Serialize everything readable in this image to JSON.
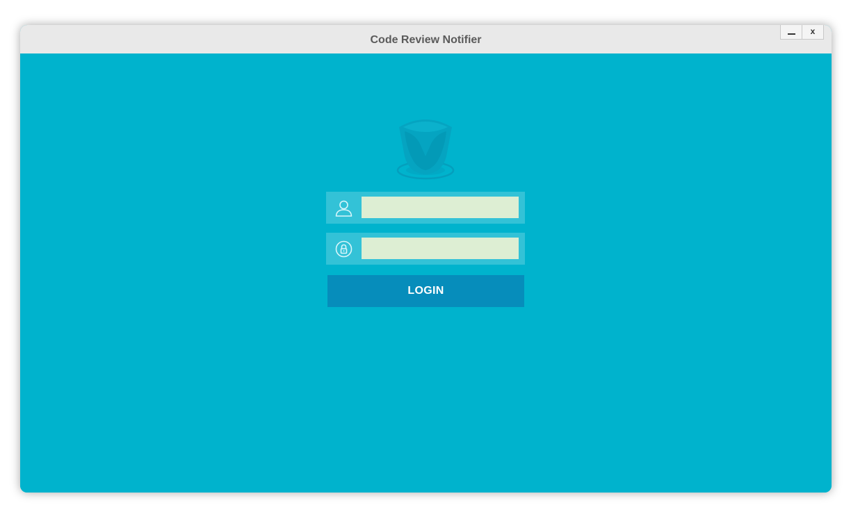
{
  "window": {
    "title": "Code Review Notifier",
    "minimize_icon": "minimize-icon",
    "close_label": "x"
  },
  "login": {
    "username_icon": "user-icon",
    "username_value": "",
    "username_placeholder": "",
    "password_icon": "lock-icon",
    "password_value": "",
    "password_placeholder": "",
    "button_label": "LOGIN"
  },
  "colors": {
    "background": "#00b3cd",
    "titlebar": "#e9e9e9",
    "input_fill": "#ddeed3",
    "button": "#068dbb"
  }
}
